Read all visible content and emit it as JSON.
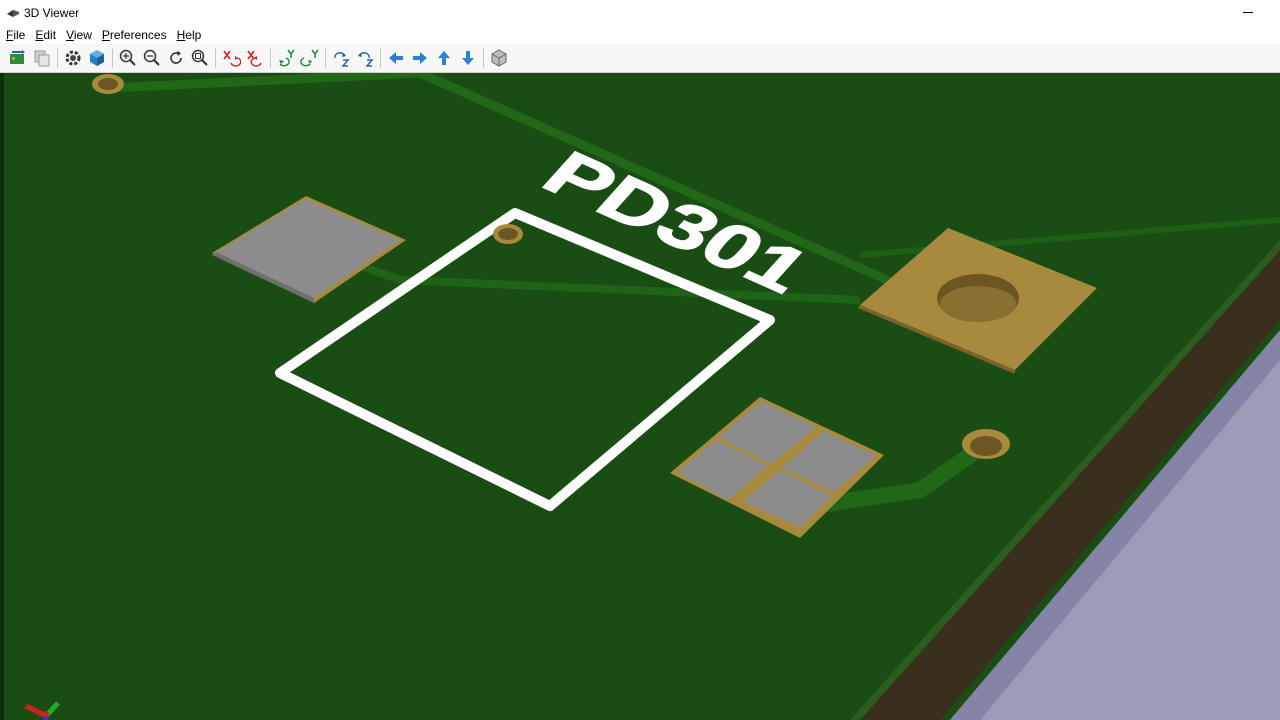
{
  "window": {
    "title": "3D Viewer"
  },
  "menu": [
    {
      "label": "File",
      "hotkey": "F",
      "rest": "ile"
    },
    {
      "label": "Edit",
      "hotkey": "E",
      "rest": "dit"
    },
    {
      "label": "View",
      "hotkey": "V",
      "rest": "iew"
    },
    {
      "label": "Preferences",
      "hotkey": "P",
      "rest": "references"
    },
    {
      "label": "Help",
      "hotkey": "H",
      "rest": "elp"
    }
  ],
  "toolbar": {
    "groups": [
      [
        "reload-board-icon",
        "copy-image-icon"
      ],
      [
        "settings-gear-icon",
        "raytracing-cube-icon"
      ],
      [
        "zoom-in-icon",
        "zoom-out-icon",
        "redraw-icon",
        "zoom-fit-icon"
      ],
      [
        "rotate-x-cw-icon",
        "rotate-x-ccw-icon"
      ],
      [
        "rotate-y-cw-icon",
        "rotate-y-ccw-icon"
      ],
      [
        "rotate-z-cw-icon",
        "rotate-z-ccw-icon"
      ],
      [
        "move-left-icon",
        "move-right-icon",
        "move-up-icon",
        "move-down-icon"
      ],
      [
        "ortho-projection-icon"
      ]
    ]
  },
  "scene": {
    "silkscreen_label": "PD301",
    "colors": {
      "board": "#1a4d13",
      "silkscreen": "#ffffff",
      "copper": "#a88a3e",
      "pad_gray": "#8c8c8c",
      "board_edge": "#3a2e1c",
      "background": "#9b9bb8"
    }
  }
}
